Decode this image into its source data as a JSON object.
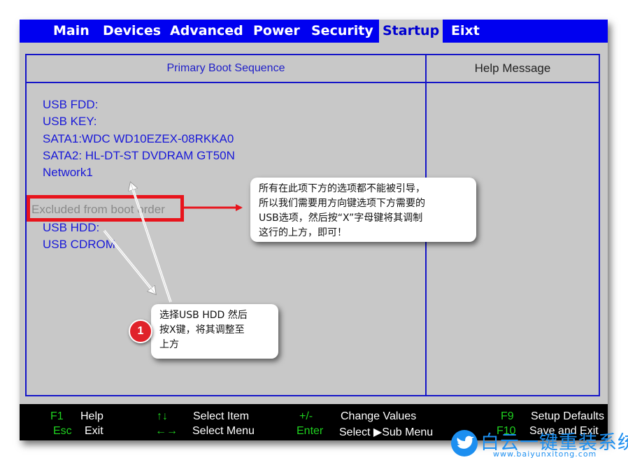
{
  "menu": {
    "items": [
      {
        "label": "Main"
      },
      {
        "label": "Devices"
      },
      {
        "label": "Advanced"
      },
      {
        "label": "Power"
      },
      {
        "label": "Security"
      },
      {
        "label": "Startup"
      },
      {
        "label": "Eixt"
      }
    ],
    "active": "Startup"
  },
  "left_panel": {
    "title": "Primary Boot Sequence",
    "boot_items": [
      "USB FDD:",
      "USB KEY:",
      "SATA1:WDC WD10EZEX-08RKKA0",
      "SATA2: HL-DT-ST DVDRAM GT50N",
      "Network1"
    ],
    "excluded_label": "Excluded from boot order",
    "excluded_items": [
      "USB HDD:",
      "USB CDROM"
    ]
  },
  "right_panel": {
    "title": "Help Message"
  },
  "footer": {
    "row1": [
      {
        "key": "F1",
        "desc": "Help"
      },
      {
        "key": "↑↓",
        "desc": "Select Item"
      },
      {
        "key": "+/-",
        "desc": "Change Values"
      },
      {
        "key": "F9",
        "desc": "Setup Defaults"
      }
    ],
    "row2": [
      {
        "key": "Esc",
        "desc": "Exit"
      },
      {
        "key": "←→",
        "desc": "Select Menu"
      },
      {
        "key": "Enter",
        "desc": "Select ▶Sub Menu"
      },
      {
        "key": "F10",
        "desc": "Save and Exit"
      }
    ]
  },
  "annotations": {
    "callout_top": [
      "所有在此项下方的选项都不能被引导，",
      "所以我们需要用方向键选项下方需要的",
      "USB选项，然后按“X”字母键将其调制",
      "这行的上方，即可！"
    ],
    "callout_bottom": [
      "选择USB HDD 然后",
      "按X键，将其调整至",
      "上方"
    ],
    "step_number": "1"
  },
  "watermark": {
    "title": "白云一键重装系统",
    "url": "www.baiyunxitong.com"
  },
  "colors": {
    "menu_bar": "#0000f0",
    "panel_bg": "#c8c8c8",
    "panel_border": "#1414c8",
    "item_text": "#1818d8",
    "footer_key": "#1fd11f",
    "highlight": "#e8141c",
    "watermark": "#1d8ff0"
  }
}
